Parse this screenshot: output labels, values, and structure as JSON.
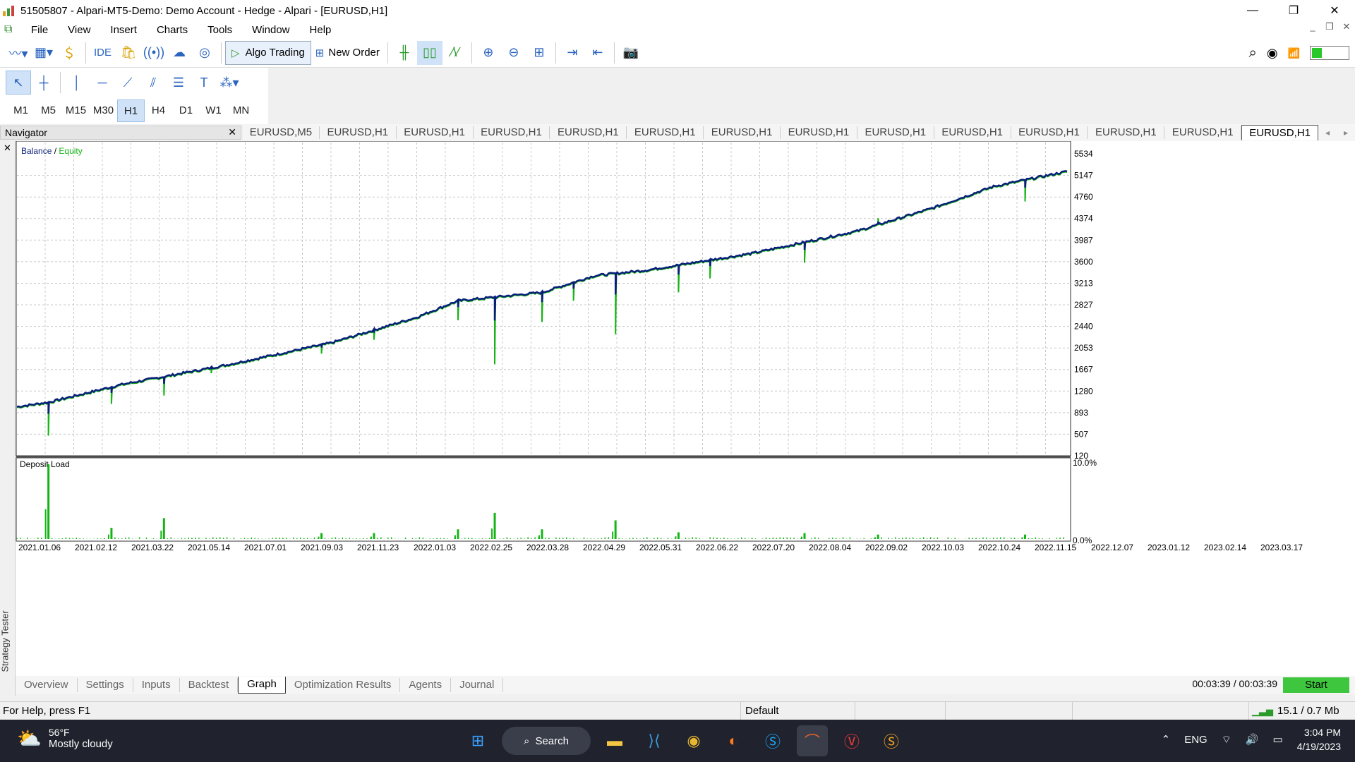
{
  "window": {
    "title": "51505807 - Alpari-MT5-Demo: Demo Account - Hedge - Alpari - [EURUSD,H1]",
    "minimize": "—",
    "restore": "❐",
    "close": "✕"
  },
  "menu": {
    "items": [
      "File",
      "View",
      "Insert",
      "Charts",
      "Tools",
      "Window",
      "Help"
    ]
  },
  "toolbar": {
    "ide": "IDE",
    "algo_trading": "Algo Trading",
    "new_order": "New Order"
  },
  "timeframes": [
    "M1",
    "M5",
    "M15",
    "M30",
    "H1",
    "H4",
    "D1",
    "W1",
    "MN"
  ],
  "selected_timeframe": "H1",
  "navigator": {
    "title": "Navigator",
    "close": "✕"
  },
  "chart_tabs": [
    "EURUSD,M5",
    "EURUSD,H1",
    "EURUSD,H1",
    "EURUSD,H1",
    "EURUSD,H1",
    "EURUSD,H1",
    "EURUSD,H1",
    "EURUSD,H1",
    "EURUSD,H1",
    "EURUSD,H1",
    "EURUSD,H1",
    "EURUSD,H1",
    "EURUSD,H1",
    "EURUSD,H1"
  ],
  "strategy_tester_label": "Strategy Tester",
  "chart_data": {
    "type": "line",
    "legend": {
      "balance": "Balance",
      "separator": " / ",
      "equity": "Equity"
    },
    "ylim": [
      120,
      5534
    ],
    "yticks": [
      "5534",
      "5147",
      "4760",
      "4374",
      "3987",
      "3600",
      "3213",
      "2827",
      "2440",
      "2053",
      "1667",
      "1280",
      "893",
      "507",
      "120"
    ],
    "colors": {
      "balance": "#0a1f7a",
      "equity": "#14b414",
      "deposit_load": "#14b414",
      "grid": "#c8c8c8"
    },
    "balance_anchor_points": [
      [
        0,
        1000
      ],
      [
        0.03,
        1080
      ],
      [
        0.1,
        1400
      ],
      [
        0.2,
        1750
      ],
      [
        0.3,
        2150
      ],
      [
        0.38,
        2600
      ],
      [
        0.42,
        2900
      ],
      [
        0.5,
        3050
      ],
      [
        0.55,
        3350
      ],
      [
        0.6,
        3450
      ],
      [
        0.7,
        3750
      ],
      [
        0.8,
        4150
      ],
      [
        0.87,
        4550
      ],
      [
        0.93,
        4950
      ],
      [
        1.0,
        5220
      ]
    ],
    "equity_dips": [
      [
        0.03,
        480
      ],
      [
        0.09,
        1050
      ],
      [
        0.14,
        1200
      ],
      [
        0.185,
        1600
      ],
      [
        0.29,
        1950
      ],
      [
        0.34,
        2200
      ],
      [
        0.42,
        2550
      ],
      [
        0.455,
        1760
      ],
      [
        0.5,
        2520
      ],
      [
        0.53,
        2900
      ],
      [
        0.57,
        2300
      ],
      [
        0.63,
        3050
      ],
      [
        0.66,
        3300
      ],
      [
        0.75,
        3580
      ],
      [
        0.82,
        4380
      ],
      [
        0.96,
        4680
      ]
    ],
    "deposit_load": {
      "label": "Deposit Load",
      "ylim": [
        0,
        10
      ],
      "yticks": [
        "10.0%",
        "0.0%"
      ],
      "spikes": [
        [
          0.03,
          10.0
        ],
        [
          0.09,
          1.5
        ],
        [
          0.14,
          2.8
        ],
        [
          0.29,
          0.8
        ],
        [
          0.34,
          0.8
        ],
        [
          0.42,
          1.3
        ],
        [
          0.455,
          3.5
        ],
        [
          0.5,
          1.3
        ],
        [
          0.57,
          2.5
        ],
        [
          0.63,
          0.9
        ],
        [
          0.75,
          0.8
        ],
        [
          0.82,
          0.6
        ],
        [
          0.96,
          0.6
        ]
      ]
    },
    "xticks": [
      "2021.01.06",
      "2021.02.12",
      "2021.03.22",
      "2021.05.14",
      "2021.07.01",
      "2021.09.03",
      "2021.11.23",
      "2022.01.03",
      "2022.02.25",
      "2022.03.28",
      "2022.04.29",
      "2022.05.31",
      "2022.06.22",
      "2022.07.20",
      "2022.08.04",
      "2022.09.02",
      "2022.10.03",
      "2022.10.24",
      "2022.11.15",
      "2022.12.07",
      "2023.01.12",
      "2023.02.14",
      "2023.03.17"
    ],
    "grid": true
  },
  "tester_tabs": [
    "Overview",
    "Settings",
    "Inputs",
    "Backtest",
    "Graph",
    "Optimization Results",
    "Agents",
    "Journal"
  ],
  "active_tester_tab": "Graph",
  "timer": "00:03:39 / 00:03:39",
  "start_button": "Start",
  "status": {
    "help": "For Help, press F1",
    "profile": "Default",
    "traffic": "15.1 / 0.7 Mb"
  },
  "taskbar": {
    "weather_temp": "56°F",
    "weather_desc": "Mostly cloudy",
    "search": "Search",
    "lang": "ENG",
    "time": "3:04 PM",
    "date": "4/19/2023"
  }
}
